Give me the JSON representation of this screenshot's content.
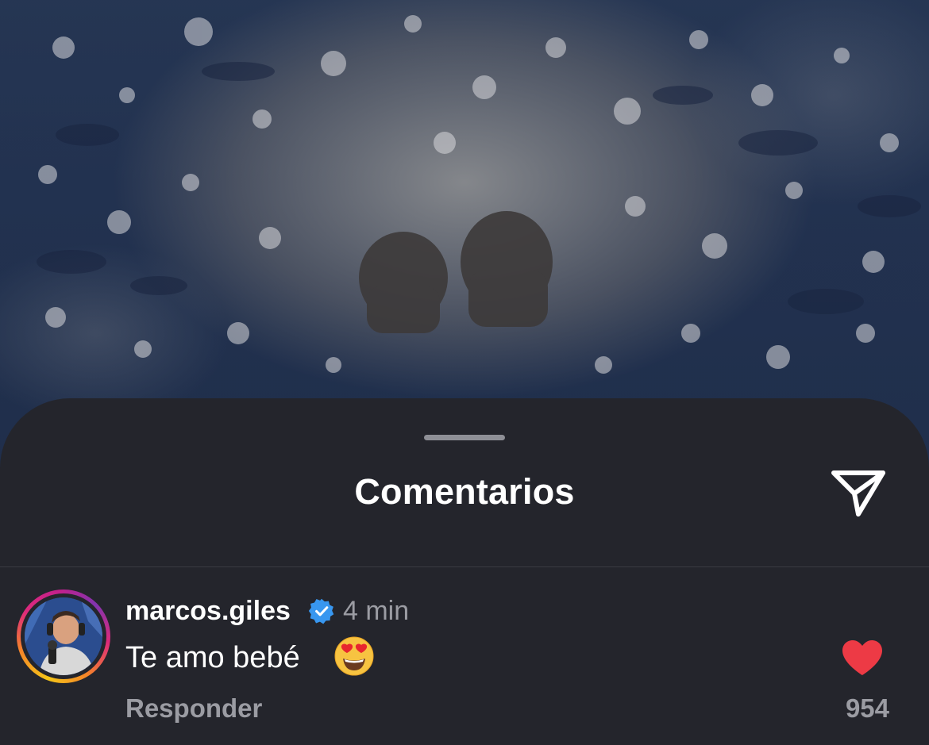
{
  "sheet": {
    "title": "Comentarios"
  },
  "comment": {
    "username": "marcos.giles",
    "verified": true,
    "time": "4 min",
    "text": "Te amo bebé",
    "emoji": "smiling-face-with-heart-eyes",
    "reply_label": "Responder",
    "like_count": "954",
    "liked": true
  },
  "colors": {
    "sheet_bg": "#24252c",
    "like_red": "#ed3a45",
    "verified_blue": "#3897f0",
    "secondary_text": "#9b9ca3"
  },
  "icons": {
    "share": "paper-plane-icon",
    "like": "heart-icon",
    "verified": "verified-badge-icon"
  }
}
